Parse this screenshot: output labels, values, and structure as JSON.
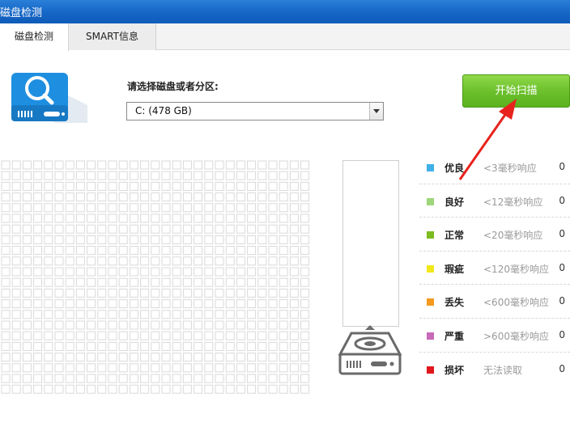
{
  "window": {
    "title": "磁盘检测"
  },
  "tabs": [
    {
      "label": "磁盘检测",
      "active": true
    },
    {
      "label": "SMART信息",
      "active": false
    }
  ],
  "disk_select": {
    "label": "请选择磁盘或者分区:",
    "value": "C:  (478 GB)"
  },
  "start_button": {
    "label": "开始扫描",
    "color": "#6cc12c"
  },
  "legend": [
    {
      "name": "优良",
      "range": "<3毫秒响应",
      "count": "0",
      "color": "#3fb0e8"
    },
    {
      "name": "良好",
      "range": "<12毫秒响应",
      "count": "0",
      "color": "#9dd67a"
    },
    {
      "name": "正常",
      "range": "<20毫秒响应",
      "count": "0",
      "color": "#7dbb1f"
    },
    {
      "name": "瑕疵",
      "range": "<120毫秒响应",
      "count": "0",
      "color": "#f2e71a"
    },
    {
      "name": "丢失",
      "range": "<600毫秒响应",
      "count": "0",
      "color": "#f39a1f"
    },
    {
      "name": "严重",
      "range": ">600毫秒响应",
      "count": "0",
      "color": "#c76ab8"
    },
    {
      "name": "损坏",
      "range": "无法读取",
      "count": "0",
      "color": "#e0161c"
    }
  ],
  "colors": {
    "titlebar": "#1566c6",
    "annotation_arrow": "#e8231d",
    "grid_cell": "#d9d9d9"
  }
}
